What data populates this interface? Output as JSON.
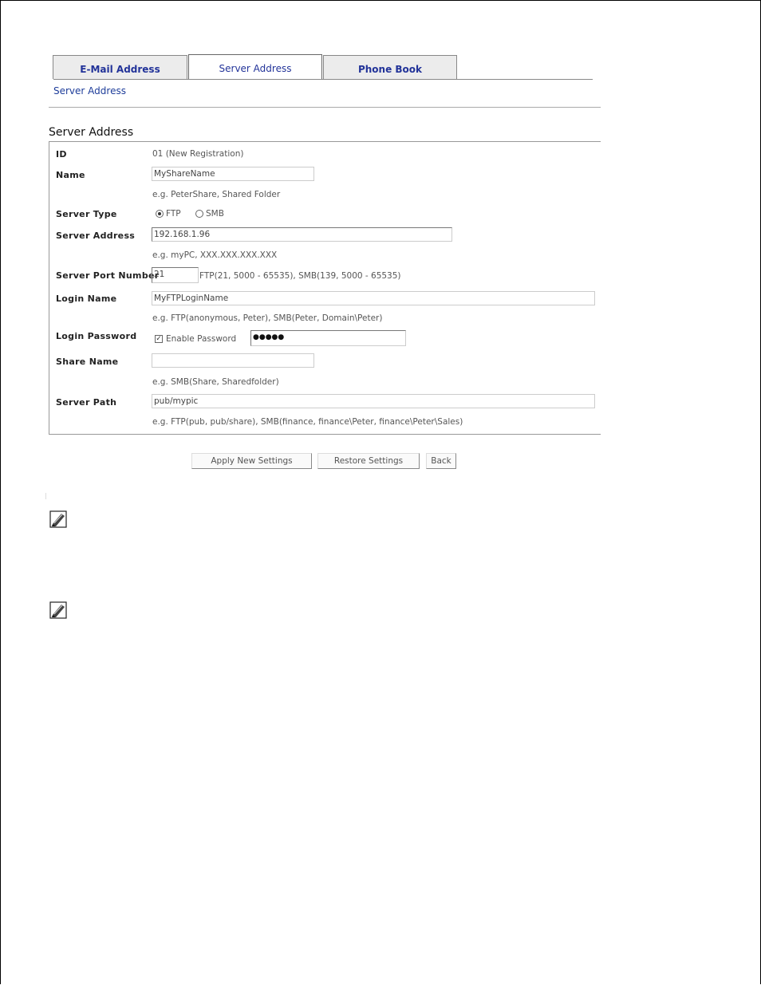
{
  "tabs": [
    {
      "label": "E-Mail Address"
    },
    {
      "label": "Server Address"
    },
    {
      "label": "Phone Book"
    }
  ],
  "subnav": {
    "link": "Server Address"
  },
  "section": {
    "title": "Server Address"
  },
  "form": {
    "id": {
      "label": "ID",
      "value": "01 (New Registration)"
    },
    "name": {
      "label": "Name",
      "value": "MyShareName",
      "hint": "e.g. PeterShare, Shared Folder"
    },
    "server_type": {
      "label": "Server Type",
      "options": [
        "FTP",
        "SMB"
      ],
      "selected": "FTP"
    },
    "server_address": {
      "label": "Server Address",
      "value": "192.168.1.96",
      "hint": "e.g. myPC, XXX.XXX.XXX.XXX"
    },
    "server_port": {
      "label": "Server Port Number",
      "value": "21",
      "hint": "FTP(21, 5000 - 65535), SMB(139, 5000 - 65535)"
    },
    "login_name": {
      "label": "Login Name",
      "value": "MyFTPLoginName",
      "hint": "e.g. FTP(anonymous, Peter), SMB(Peter, Domain\\Peter)"
    },
    "login_password": {
      "label": "Login Password",
      "enable_label": "Enable Password",
      "enabled": true,
      "value": "●●●●●"
    },
    "share_name": {
      "label": "Share Name",
      "value": "",
      "hint": "e.g. SMB(Share, Sharedfolder)"
    },
    "server_path": {
      "label": "Server Path",
      "value": "pub/mypic",
      "hint": "e.g. FTP(pub, pub/share), SMB(finance, finance\\Peter, finance\\Peter\\Sales)"
    }
  },
  "buttons": {
    "apply": "Apply New Settings",
    "restore": "Restore Settings",
    "back": "Back"
  },
  "icons": {
    "note": "note-pencil-icon"
  }
}
